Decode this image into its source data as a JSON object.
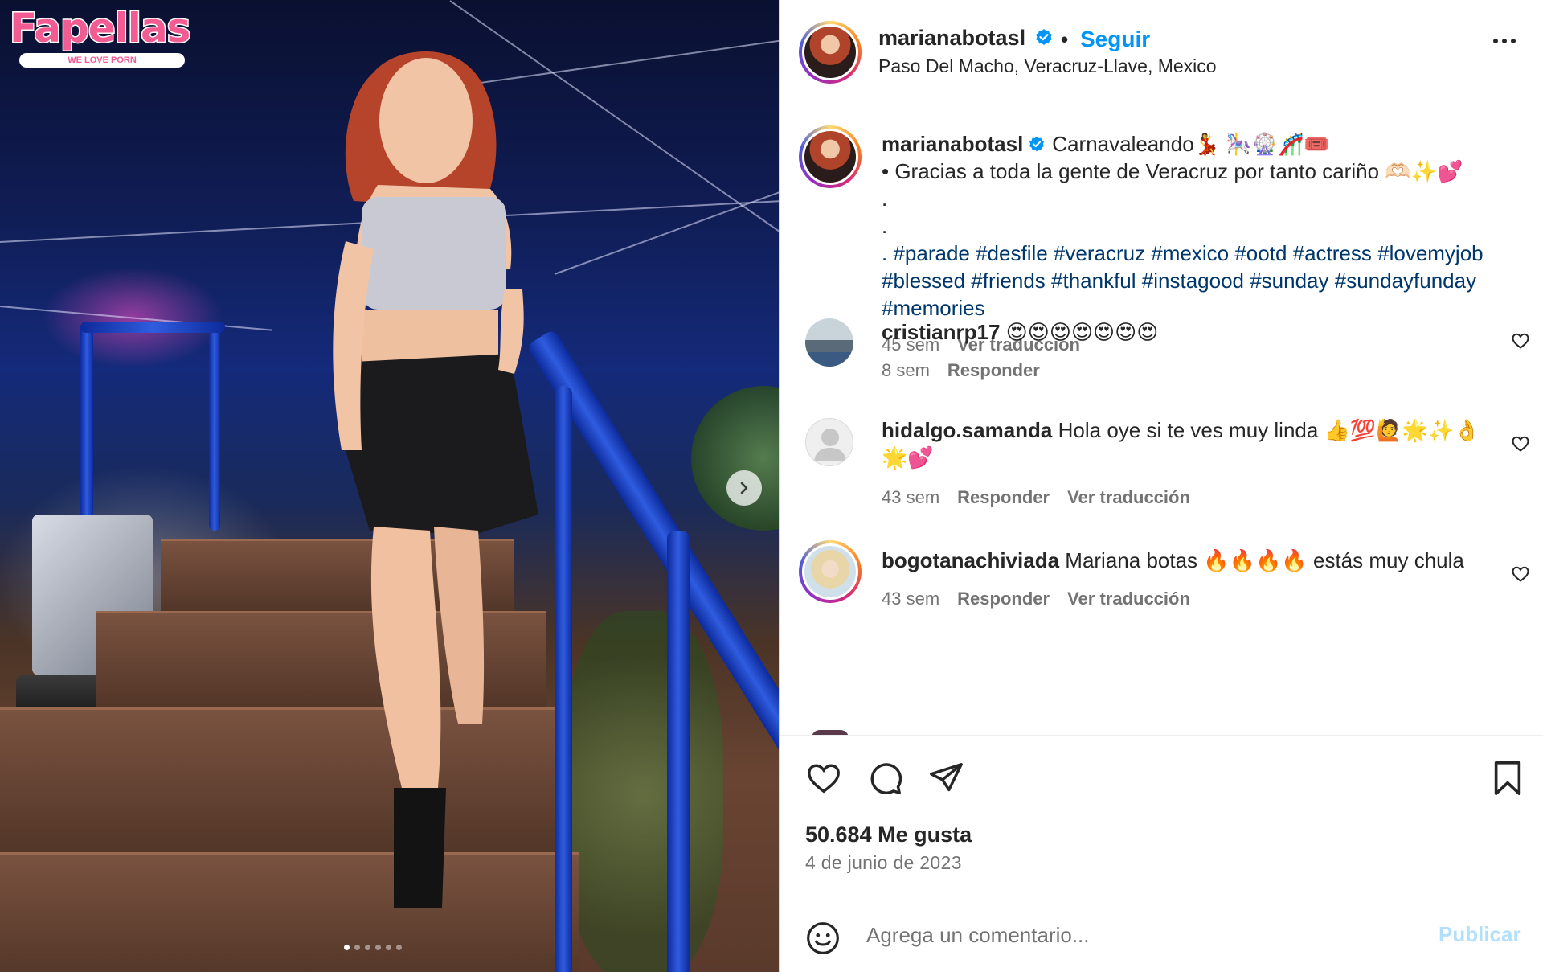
{
  "watermark": {
    "name": "Fapellas",
    "tagline": "WE LOVE PORN"
  },
  "post_header": {
    "username": "marianabotasl",
    "separator": "•",
    "follow_label": "Seguir",
    "location": "Paso Del Macho, Veracruz-Llave, Mexico"
  },
  "caption": {
    "username": "marianabotasl",
    "line1": "Carnavaleando💃 🎠🎡🎢🎟️",
    "line2": "• Gracias a toda la gente de Veracruz por tanto cariño 🫶🏻✨💕",
    "dot1": ".",
    "dot2": ".",
    "tags": ". #parade #desfile #veracruz #mexico #ootd #actress #lovemyjob #blessed #friends #thankful #instagood #sunday #sundayfunday #memories",
    "age": "45 sem",
    "translate_label": "Ver traducción"
  },
  "comments": [
    {
      "username": "cristianrp17",
      "text": "😍😍😍😍😍😍😍",
      "age": "8 sem",
      "reply_label": "Responder",
      "translate_label": ""
    },
    {
      "username": "hidalgo.samanda",
      "text": "Hola oye si te ves muy linda 👍💯🙋🌟✨👌🌟💕",
      "age": "43 sem",
      "reply_label": "Responder",
      "translate_label": "Ver traducción"
    },
    {
      "username": "bogotanachiviada",
      "text": "Mariana botas 🔥🔥🔥🔥 estás muy chula",
      "age": "43 sem",
      "reply_label": "Responder",
      "translate_label": "Ver traducción"
    }
  ],
  "stats": {
    "likes": "50.684 Me gusta",
    "date": "4 de junio de 2023"
  },
  "composer": {
    "placeholder": "Agrega un comentario...",
    "publish_label": "Publicar"
  },
  "carousel": {
    "current_slide": 1,
    "total_slides": 6
  },
  "icons": {
    "verified": "verified-badge-icon",
    "more": "more-options-icon",
    "like": "heart-icon",
    "comment": "comment-bubble-icon",
    "share": "paper-plane-icon",
    "save": "bookmark-icon",
    "emoji": "emoji-smiley-icon",
    "next": "chevron-right-icon"
  },
  "colors": {
    "link_blue": "#0095f6",
    "hashtag_blue": "#00376b",
    "publish_disabled": "#b2dffc",
    "muted": "#737373",
    "watermark_pink": "#f25c92"
  }
}
